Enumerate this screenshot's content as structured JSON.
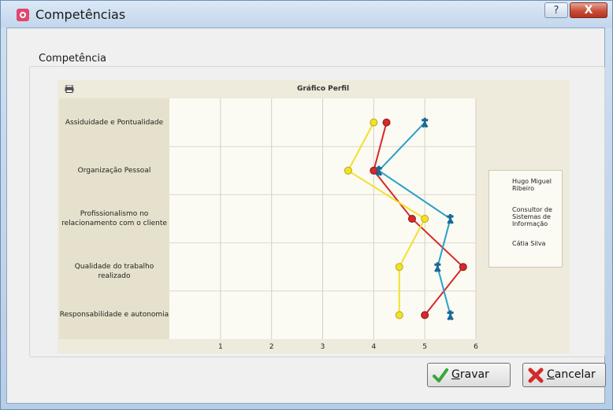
{
  "window": {
    "title": "Competências",
    "help_label": "?",
    "close_label": "X"
  },
  "group": {
    "label": "Competência"
  },
  "chart_data": {
    "type": "line",
    "title": "Gráfico Perfil",
    "categories": [
      "Assiduidade e Pontualidade",
      "Organização Pessoal",
      "Profissionalismo no relacionamento com o cliente",
      "Qualidade do trabalho realizado",
      "Responsabilidade e autonomia"
    ],
    "category_lines": [
      [
        "Assiduidade e Pontualidade"
      ],
      [
        "Organização Pessoal"
      ],
      [
        "Profissionalismo no",
        "relacionamento com o cliente"
      ],
      [
        "Qualidade do trabalho realizado"
      ],
      [
        "Responsabilidade e autonomia"
      ]
    ],
    "x_ticks": [
      "1",
      "2",
      "3",
      "4",
      "5",
      "6"
    ],
    "xlim": [
      0,
      6
    ],
    "orientation": "horizontal",
    "grid": true,
    "legend_position": "right",
    "series": [
      {
        "name": "Hugo Miguel Ribeiro",
        "legend_lines": [
          "Hugo Miguel",
          "Ribeiro"
        ],
        "color": "#d42a2a",
        "marker": "circle",
        "values": [
          4.25,
          4.0,
          4.75,
          5.75,
          5.0
        ]
      },
      {
        "name": "Consultor de Sistemas de Informação",
        "legend_lines": [
          "Consultor de",
          "Sistemas de",
          "Informação"
        ],
        "color": "#2aa0c8",
        "marker": "person",
        "values": [
          5.0,
          4.1,
          5.5,
          5.25,
          5.5
        ]
      },
      {
        "name": "Cátia Silva",
        "legend_lines": [
          "Cátia Silva"
        ],
        "color": "#f2e12a",
        "marker": "circle",
        "values": [
          4.0,
          3.5,
          5.0,
          4.5,
          4.5
        ]
      }
    ]
  },
  "buttons": {
    "save": {
      "label_first": "G",
      "label_rest": "ravar",
      "icon": "check-icon",
      "color": "#3aa53a"
    },
    "cancel": {
      "label_first": "C",
      "label_rest": "ancelar",
      "icon": "cross-icon",
      "color": "#d42a2a"
    }
  }
}
